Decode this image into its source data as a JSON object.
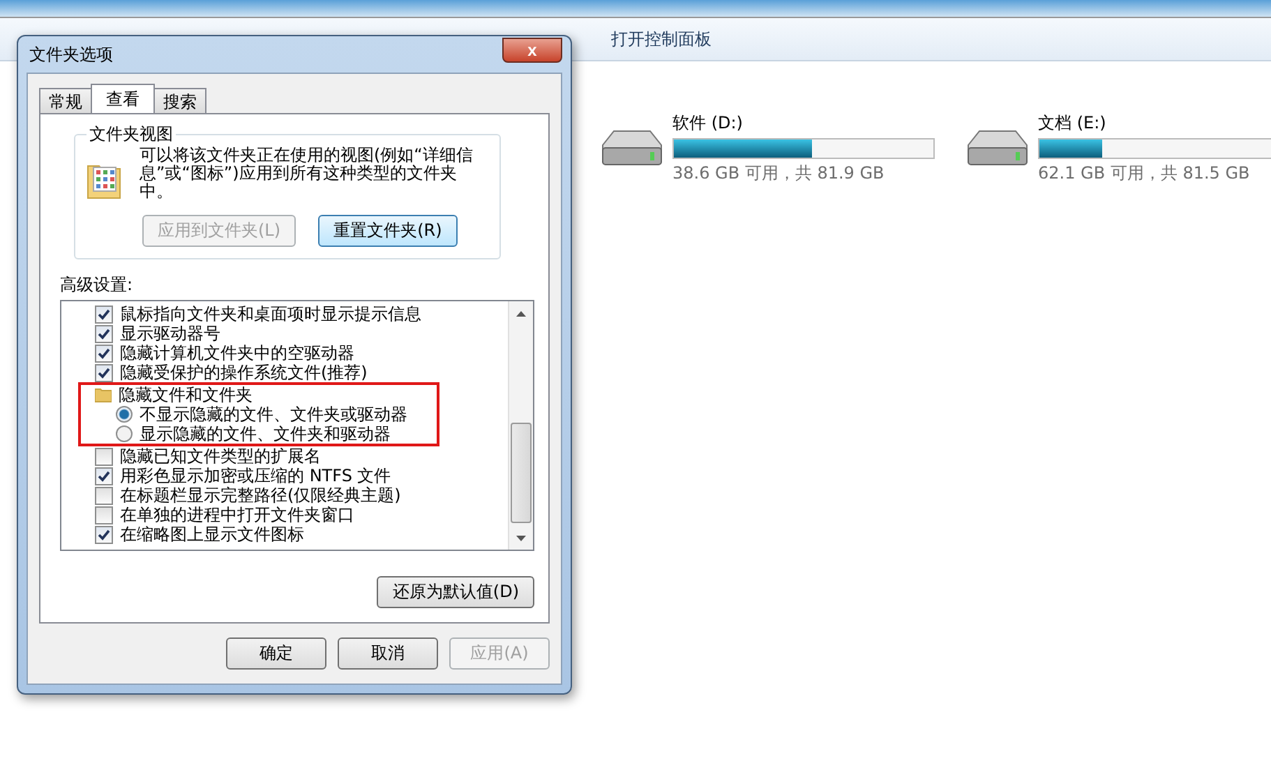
{
  "toolbar": {
    "items": [
      "打开控制面板"
    ]
  },
  "drives": [
    {
      "name": "软件 (D:)",
      "level": 0.53,
      "space": "38.6 GB 可用，共 81.9 GB"
    },
    {
      "name": "文档 (E:)",
      "level": 0.24,
      "space": "62.1 GB 可用，共 81.5 GB"
    }
  ],
  "dialog": {
    "title": "文件夹选项",
    "close": "x",
    "tabs": [
      {
        "label": "常规",
        "selected": false
      },
      {
        "label": "查看",
        "selected": true
      },
      {
        "label": "搜索",
        "selected": false
      }
    ],
    "folder_views": {
      "title": "文件夹视图",
      "description": "可以将该文件夹正在使用的视图(例如“详细信息”或“图标”)应用到所有这种类型的文件夹中。",
      "buttons": [
        {
          "label": "应用到文件夹(L)",
          "disabled": true
        },
        {
          "label": "重置文件夹(R)",
          "disabled": false
        }
      ]
    },
    "advanced_label": "高级设置:",
    "settings": [
      {
        "kind": "checkbox",
        "label": "鼠标指向文件夹和桌面项时显示提示信息",
        "checked": true
      },
      {
        "kind": "checkbox",
        "label": "显示驱动器号",
        "checked": true
      },
      {
        "kind": "checkbox",
        "label": "隐藏计算机文件夹中的空驱动器",
        "checked": true
      },
      {
        "kind": "checkbox",
        "label": "隐藏受保护的操作系统文件(推荐)",
        "checked": true
      },
      {
        "kind": "folder",
        "label": "隐藏文件和文件夹",
        "children": [
          {
            "kind": "radio",
            "label": "不显示隐藏的文件、文件夹或驱动器",
            "selected": true
          },
          {
            "kind": "radio",
            "label": "显示隐藏的文件、文件夹和驱动器",
            "selected": false
          }
        ]
      },
      {
        "kind": "checkbox",
        "label": "隐藏已知文件类型的扩展名",
        "checked": false
      },
      {
        "kind": "checkbox",
        "label": "用彩色显示加密或压缩的 NTFS 文件",
        "checked": true
      },
      {
        "kind": "checkbox",
        "label": "在标题栏显示完整路径(仅限经典主题)",
        "checked": false
      },
      {
        "kind": "checkbox",
        "label": "在单独的进程中打开文件夹窗口",
        "checked": false
      },
      {
        "kind": "checkbox",
        "label": "在缩略图上显示文件图标",
        "checked": true
      }
    ],
    "restore_button": {
      "label": "还原为默认值(D)"
    },
    "buttons": [
      {
        "label": "确定",
        "disabled": false
      },
      {
        "label": "取消",
        "disabled": false
      },
      {
        "label": "应用(A)",
        "disabled": true
      }
    ]
  }
}
